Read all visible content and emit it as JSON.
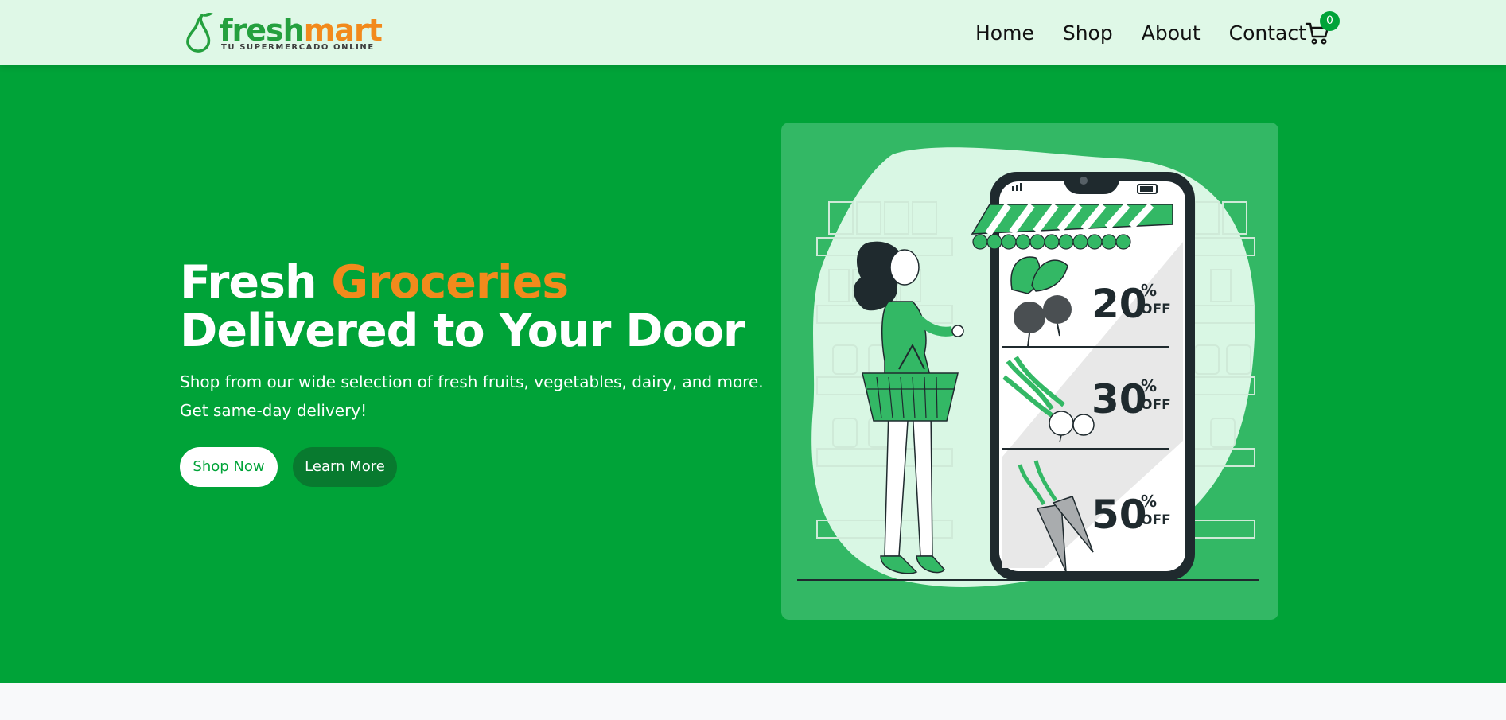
{
  "brand": {
    "name_part1": "fresh",
    "name_part2": "mart",
    "tagline": "TU SUPERMERCADO ONLINE",
    "colors": {
      "green": "#24a03e",
      "orange": "#f28a1c"
    }
  },
  "nav": {
    "items": [
      {
        "label": "Home"
      },
      {
        "label": "Shop"
      },
      {
        "label": "About"
      },
      {
        "label": "Contact"
      }
    ],
    "cart": {
      "icon": "cart-icon",
      "count": "0"
    }
  },
  "hero": {
    "title_part1": "Fresh ",
    "title_accent": "Groceries",
    "title_part2": " Delivered to Your Door",
    "subtitle": "Shop from our wide selection of fresh fruits, vegetables, dairy, and more. Get same-day delivery!",
    "buttons": {
      "shop_now": "Shop Now",
      "learn_more": "Learn More"
    },
    "background": "#00a338",
    "accent_color": "#f28a1c"
  },
  "illustration": {
    "offers": [
      {
        "item": "beets",
        "number": "20",
        "pct": "%",
        "off": "OFF"
      },
      {
        "item": "radishes",
        "number": "30",
        "pct": "%",
        "off": "OFF"
      },
      {
        "item": "carrots",
        "number": "50",
        "pct": "%",
        "off": "OFF"
      }
    ]
  }
}
